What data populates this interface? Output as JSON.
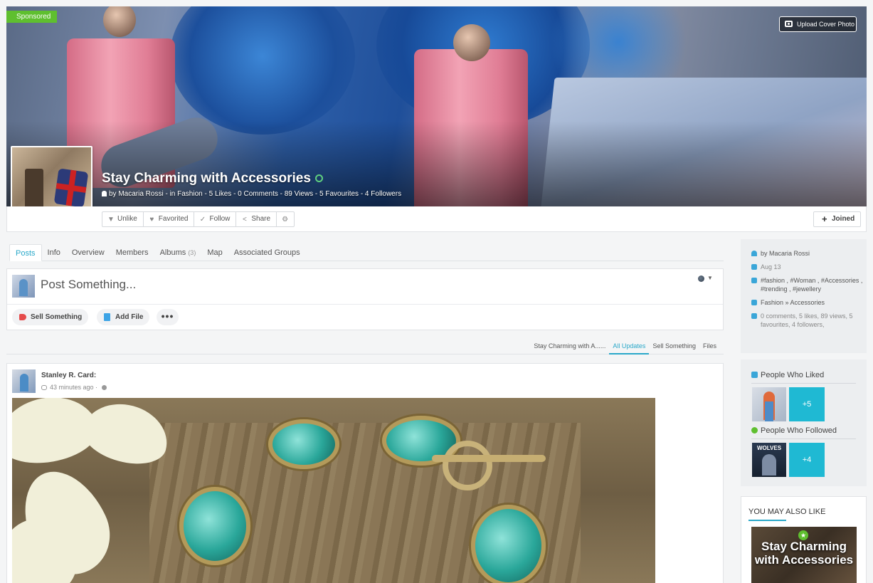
{
  "badge": {
    "sponsored": "Sponsored"
  },
  "cover": {
    "upload_label": "Upload Cover Photo"
  },
  "group": {
    "title": "Stay Charming with Accessories",
    "meta": "by Macaria Rossi  -  in Fashion - 5 Likes - 0 Comments - 89 Views - 5 Favourites - 4 Followers"
  },
  "actions": {
    "unlike": "Unlike",
    "favorited": "Favorited",
    "follow": "Follow",
    "share": "Share",
    "joined": "Joined"
  },
  "tabs": [
    {
      "label": "Posts"
    },
    {
      "label": "Info"
    },
    {
      "label": "Overview"
    },
    {
      "label": "Members"
    },
    {
      "label": "Albums",
      "count": "(3)"
    },
    {
      "label": "Map"
    },
    {
      "label": "Associated Groups"
    }
  ],
  "composer": {
    "placeholder": "Post Something...",
    "sell": "Sell Something",
    "add_file": "Add File",
    "more": "•••"
  },
  "filters": [
    "Stay Charming with A......",
    "All Updates",
    "Sell Something",
    "Files"
  ],
  "feed": {
    "user": "Stanley R. Card:",
    "time": "43 minutes ago"
  },
  "sidebar": {
    "owner": "by Macaria Rossi",
    "date": "Aug 13",
    "tags": "#fashion , #Woman , #Accessories , #trending , #jewellery",
    "category": "Fashion  » Accessories",
    "stats": "0 comments, 5 likes, 89 views, 5 favourites, 4 followers,",
    "liked_title": "People Who Liked",
    "liked_more": "+5",
    "followed_title": "People Who Followed",
    "followed_more": "+4",
    "follower_thumb_text": "WOLVES",
    "also_like_title": "YOU MAY ALSO LIKE",
    "also_like_card": "Stay Charming with Accessories"
  },
  "colors": {
    "accent": "#2aa8c9",
    "sponsored": "#5fbf2f",
    "tile": "#1fb9d3"
  }
}
